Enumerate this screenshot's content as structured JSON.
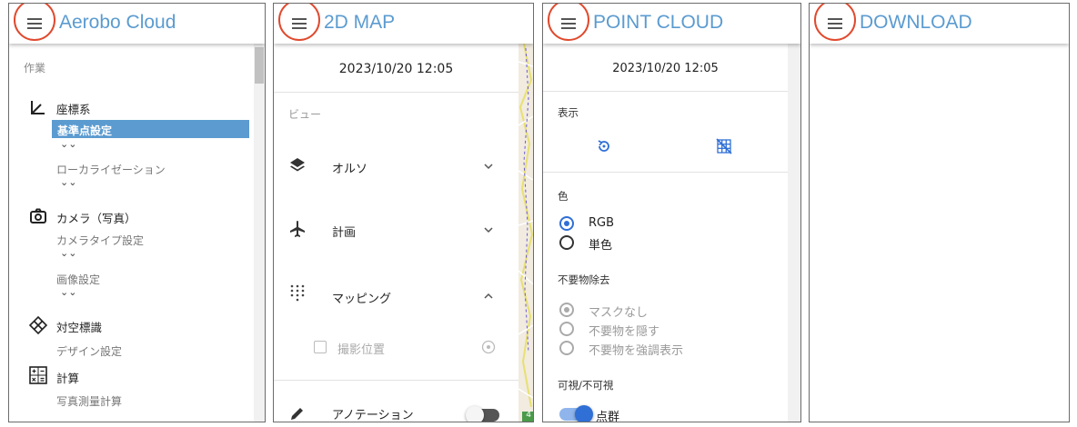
{
  "panel1": {
    "title": "Aerobo Cloud",
    "work_label": "作業",
    "sections": [
      {
        "label": "座標系",
        "icon": "axis-icon"
      },
      {
        "label": "カメラ（写真）",
        "icon": "camera-icon"
      },
      {
        "label": "対空標識",
        "icon": "target-marker-icon"
      },
      {
        "label": "計算",
        "icon": "calculator-icon"
      }
    ],
    "items": {
      "base_point": "基準点設定",
      "localization": "ローカライゼーション",
      "camera_type": "カメラタイプ設定",
      "image_settings": "画像設定",
      "design_settings": "デザイン設定",
      "photogrammetry": "写真測量計算"
    },
    "expand_glyph": "⌄⌄"
  },
  "panel2": {
    "title": "2D MAP",
    "date": "2023/10/20 12:05",
    "view_label": "ビュー",
    "rows": [
      {
        "label": "オルソ",
        "icon": "layers-icon",
        "state": "collapsed"
      },
      {
        "label": "計画",
        "icon": "airplane-icon",
        "state": "collapsed"
      },
      {
        "label": "マッピング",
        "icon": "dots-grid-icon",
        "state": "expanded"
      }
    ],
    "shoot_position": "撮影位置",
    "annotation": "アノテーション",
    "annotation_on": false,
    "map_badge": "4"
  },
  "panel3": {
    "title": "POINT CLOUD",
    "date": "2023/10/20 12:05",
    "display_label": "表示",
    "color_label": "色",
    "color_options": [
      "RGB",
      "単色"
    ],
    "color_selected": "RGB",
    "removal_label": "不要物除去",
    "removal_options": [
      "マスクなし",
      "不要物を隠す",
      "不要物を強調表示"
    ],
    "removal_selected": "マスクなし",
    "visibility_label": "可視/不可視",
    "point_group": "点群",
    "point_group_on": true
  },
  "panel4": {
    "title": "DOWNLOAD"
  },
  "colors": {
    "accent": "#5b9bd0",
    "highlight_circle": "#e04a2e",
    "toggle_on": "#2f6fd6"
  }
}
